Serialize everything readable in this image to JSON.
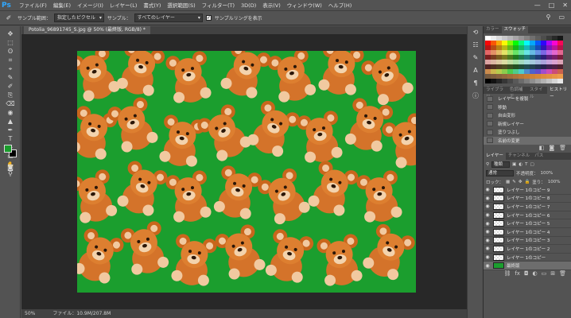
{
  "app": {
    "logo": "Ps"
  },
  "menu": [
    "ファイル(F)",
    "編集(E)",
    "イメージ(I)",
    "レイヤー(L)",
    "書式(Y)",
    "選択範囲(S)",
    "フィルター(T)",
    "3D(D)",
    "表示(V)",
    "ウィンドウ(W)",
    "ヘルプ(H)"
  ],
  "window_controls": {
    "minimize": "—",
    "maximize": "□",
    "close": "✕"
  },
  "options": {
    "sample_size_label": "サンプル範囲：",
    "sample_size_value": "指定したピクセル",
    "sample_label": "サンプル：",
    "sample_value": "すべてのレイヤー",
    "checkbox_label": "サンプルリングを表示",
    "checkbox_checked": true
  },
  "document": {
    "tab_label": "Potolia_96891745_S.jpg @ 50% (最終版, RGB/8) *",
    "zoom": "50%",
    "file_info": "ファイル：10.9M/207.8M"
  },
  "tools": [
    "✥",
    "⬚",
    "ʘ",
    "⌗",
    "⌖",
    "✎",
    "✐",
    "⎘",
    "⌫",
    "◉",
    "▲",
    "✒",
    "T",
    "➤",
    "▭",
    "✋",
    "⚲"
  ],
  "colors": {
    "foreground": "#1a9c2c",
    "background": "#000000",
    "canvas_green": "#1b9e2e"
  },
  "swatch_panel": {
    "tabs": [
      "カラー",
      "スウォッチ"
    ],
    "active": 1
  },
  "history_panel": {
    "tabs": [
      "ライブラリ",
      "色調補正",
      "スタイル",
      "ヒストリー"
    ],
    "active": 3,
    "items": [
      "レイヤーを複製",
      "移動",
      "自由変形",
      "新規レイヤー",
      "塗りつぶし",
      "名前の変更"
    ],
    "selected": 5
  },
  "layers_panel": {
    "tabs": [
      "レイヤー",
      "チャンネル",
      "パス"
    ],
    "active": 0,
    "filter_label": "種類",
    "blend_mode": "通常",
    "opacity_label": "不透明度：",
    "opacity_value": "100%",
    "lock_label": "ロック：",
    "fill_label": "塗り：",
    "fill_value": "100%",
    "layers": [
      "レイヤー 1のコピー 9",
      "レイヤー 1のコピー 8",
      "レイヤー 1のコピー 7",
      "レイヤー 1のコピー 6",
      "レイヤー 1のコピー 5",
      "レイヤー 1のコピー 4",
      "レイヤー 1のコピー 3",
      "レイヤー 1のコピー 2",
      "レイヤー 1のコピー",
      "最終版"
    ],
    "selected": 9
  }
}
